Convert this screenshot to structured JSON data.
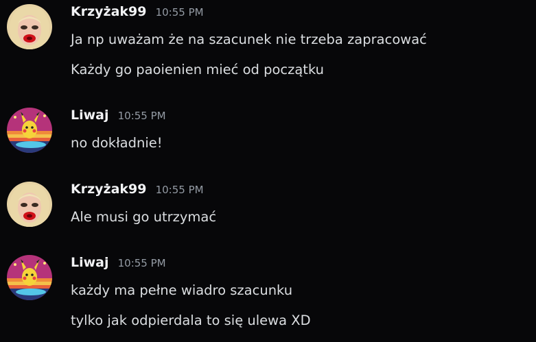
{
  "messages": [
    {
      "author": "Krzyżak99",
      "avatar": "blonde-woman-red-lips-avatar",
      "time": "10:55 PM",
      "lines": [
        "Ja np uważam że na szacunek nie trzeba zapracować",
        "Każdy go paoienien mieć od początku"
      ]
    },
    {
      "author": "Liwaj",
      "avatar": "pikachu-surfing-avatar",
      "time": "10:55 PM",
      "lines": [
        "no dokładnie!"
      ]
    },
    {
      "author": "Krzyżak99",
      "avatar": "blonde-woman-red-lips-avatar",
      "time": "10:55 PM",
      "lines": [
        "Ale musi go utrzymać"
      ]
    },
    {
      "author": "Liwaj",
      "avatar": "pikachu-surfing-avatar",
      "time": "10:55 PM",
      "lines": [
        "każdy ma pełne wiadro szacunku",
        "tylko jak odpierdala to się ulewa XD"
      ]
    }
  ]
}
